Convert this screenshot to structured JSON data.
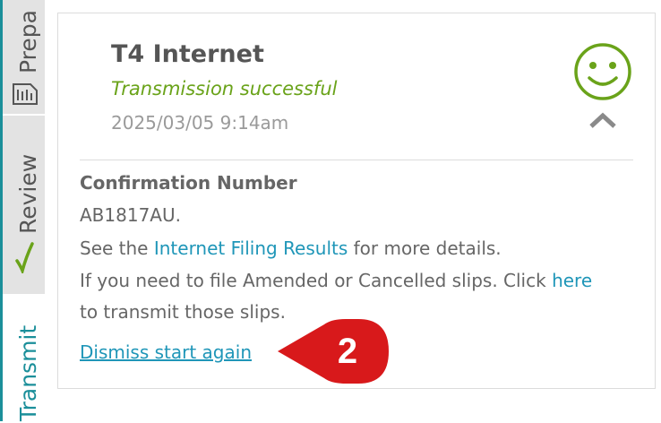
{
  "tabs": {
    "prepare": "Prepa",
    "review": "Review",
    "transmit": "Transmit"
  },
  "card": {
    "title": "T4 Internet",
    "status": "Transmission successful",
    "datetime": "2025/03/05 9:14am",
    "status_icon": "smiley-icon",
    "confirmation_label": "Confirmation Number",
    "confirmation_number": "AB1817AU.",
    "see_prefix": "See the ",
    "results_link": "Internet Filing Results",
    "see_suffix": " for more details.",
    "amend_text": "If you need to file Amended or Cancelled slips. Click ",
    "here_link": "here",
    "amend_suffix": "to transmit those slips.",
    "dismiss_link": "Dismiss start again"
  },
  "callout": {
    "number": "2"
  },
  "colors": {
    "accent": "#1b8f9a",
    "success": "#6aa31a",
    "link": "#1f96b8",
    "callout": "#d8191b"
  }
}
